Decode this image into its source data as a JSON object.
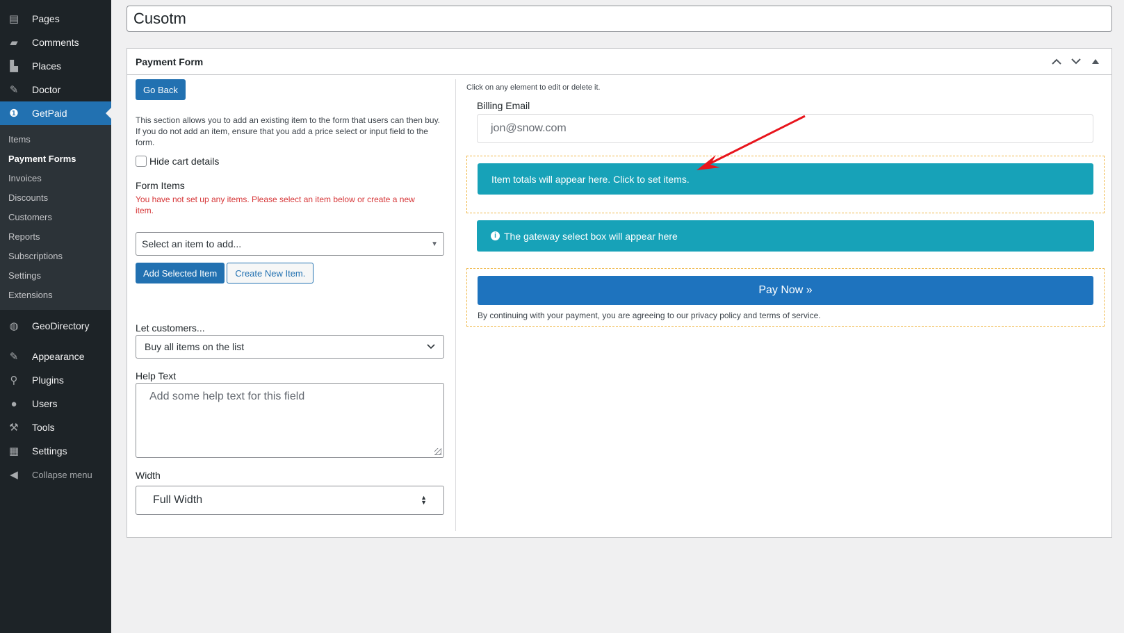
{
  "sidebar": {
    "menu": [
      {
        "label": "Pages",
        "icon": "pages-icon"
      },
      {
        "label": "Comments",
        "icon": "comments-icon"
      },
      {
        "label": "Places",
        "icon": "places-icon"
      },
      {
        "label": "Doctor",
        "icon": "doctor-icon"
      },
      {
        "label": "GetPaid",
        "icon": "getpaid-icon"
      }
    ],
    "submenu": [
      "Items",
      "Payment Forms",
      "Invoices",
      "Discounts",
      "Customers",
      "Reports",
      "Subscriptions",
      "Settings",
      "Extensions"
    ],
    "menu2": [
      {
        "label": "GeoDirectory",
        "icon": "geodirectory-icon"
      },
      {
        "label": "Appearance",
        "icon": "appearance-icon"
      },
      {
        "label": "Plugins",
        "icon": "plugins-icon"
      },
      {
        "label": "Users",
        "icon": "users-icon"
      },
      {
        "label": "Tools",
        "icon": "tools-icon"
      },
      {
        "label": "Settings",
        "icon": "settings-icon"
      }
    ],
    "collapse": "Collapse menu"
  },
  "title_value": "Cusotm",
  "postbox": {
    "title": "Payment Form",
    "left": {
      "go_back": "Go Back",
      "description": "This section allows you to add an existing item to the form that users can then buy. If you do not add an item, ensure that you add a price select or input field to the form.",
      "hide_cart": "Hide cart details",
      "form_items_label": "Form Items",
      "form_items_error": "You have not set up any items. Please select an item below or create a new item.",
      "select_item_placeholder": "Select an item to add...",
      "add_selected": "Add Selected Item",
      "create_new": "Create New Item.",
      "let_customers_label": "Let customers...",
      "let_customers_value": "Buy all items on the list",
      "help_text_label": "Help Text",
      "help_text_placeholder": "Add some help text for this field",
      "width_label": "Width",
      "width_value": "Full Width"
    },
    "right": {
      "hint": "Click on any element to edit or delete it.",
      "billing_email_label": "Billing Email",
      "billing_email_placeholder": "jon@snow.com",
      "item_totals": "Item totals will appear here. Click to set items.",
      "gateway_notice": "The gateway select box will appear here",
      "pay_now": "Pay Now »",
      "terms_note": "By continuing with your payment, you are agreeing to our privacy policy and terms of service."
    }
  },
  "colors": {
    "primary": "#2271b1",
    "info": "#17a2b8",
    "pay": "#1e73be",
    "error": "#d63638",
    "annotation_arrow": "#e8141c"
  }
}
